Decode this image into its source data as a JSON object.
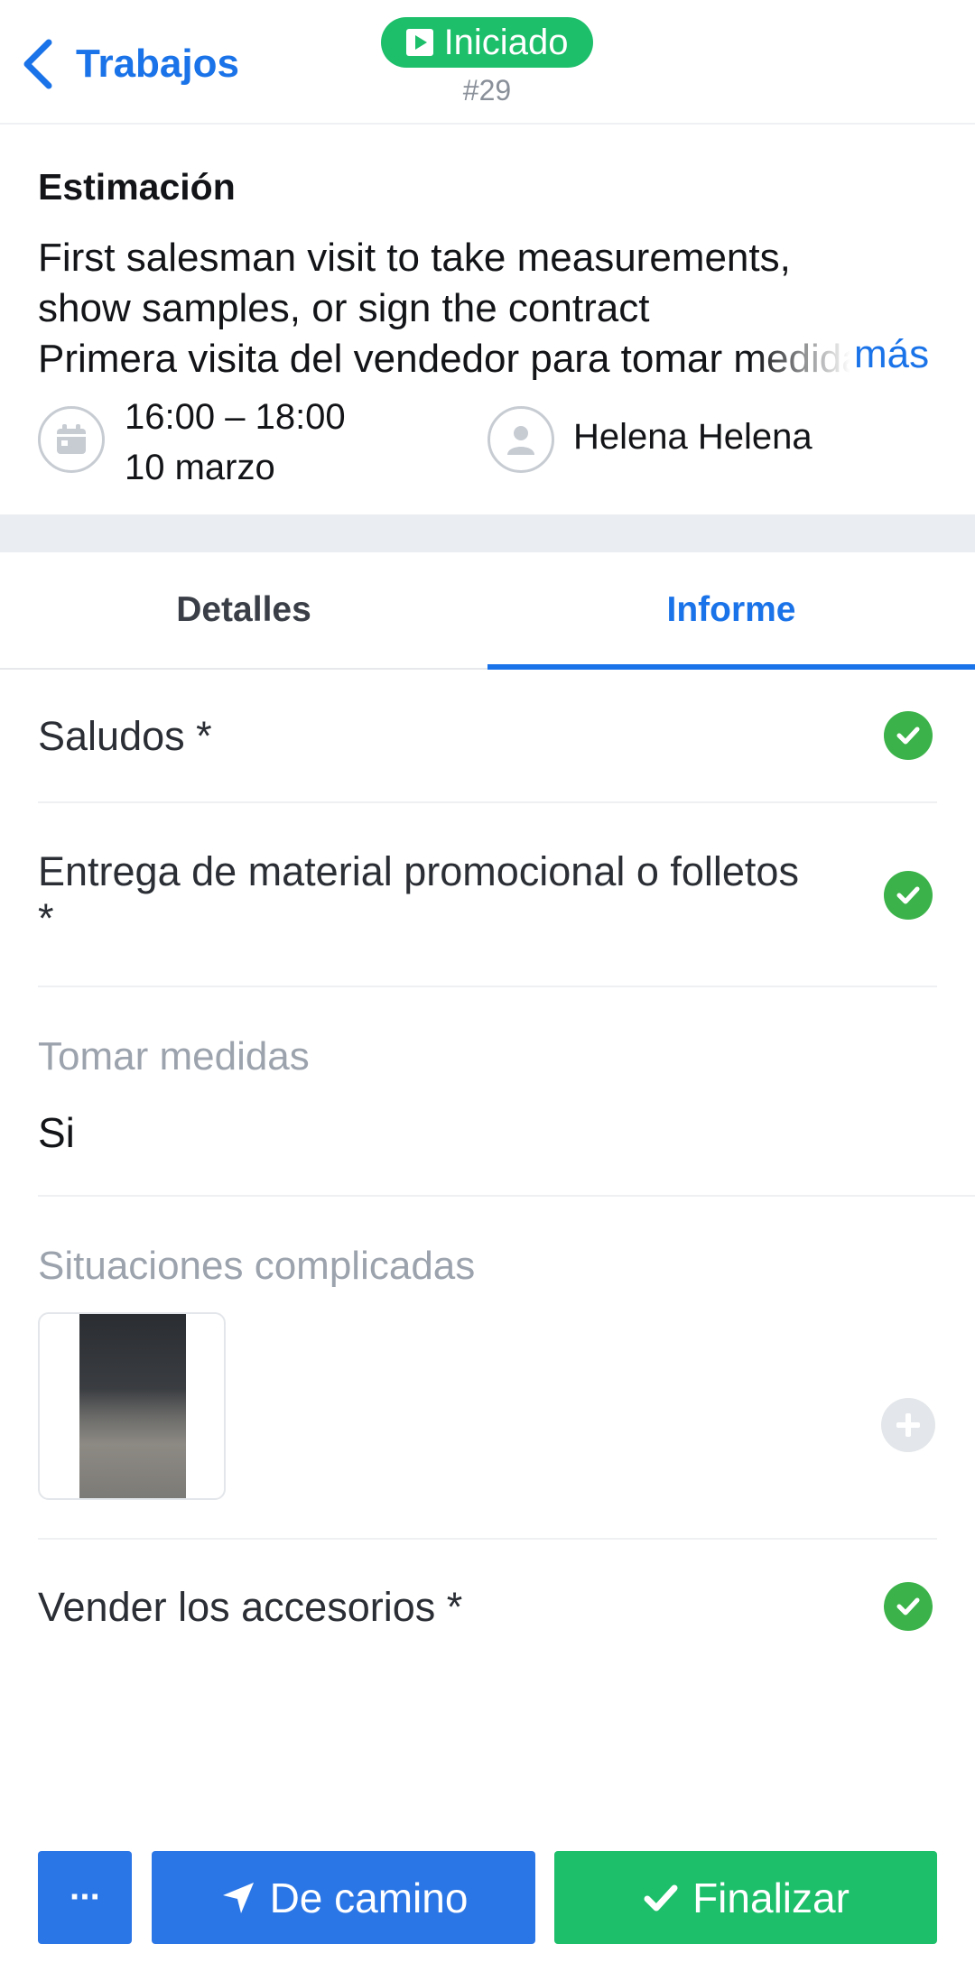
{
  "header": {
    "back_label": "Trabajos",
    "status_label": "Iniciado",
    "job_number": "#29"
  },
  "estimation": {
    "title": "Estimación",
    "description_lines": [
      "First salesman visit to take measurements,",
      "show samples, or sign the contract",
      "Primera visita del vendedor para tomar medidas"
    ],
    "more_label": "más",
    "time_range": "16:00 – 18:00",
    "date": "10 marzo",
    "assignee": "Helena Helena"
  },
  "tabs": [
    {
      "label": "Detalles",
      "active": false
    },
    {
      "label": "Informe",
      "active": true
    }
  ],
  "report": {
    "greetings": {
      "label": "Saludos *",
      "done": true
    },
    "promo": {
      "label_line1": "Entrega de material promocional o folletos",
      "label_line2": "*",
      "done": true
    },
    "measurements": {
      "label": "Tomar medidas",
      "value": "Si"
    },
    "complications": {
      "label": "Situaciones complicadas",
      "photo_count": 1
    },
    "accessories": {
      "label": "Vender los accesorios *",
      "done": true
    }
  },
  "actions": {
    "more_label": "···",
    "on_way_label": "De camino",
    "finish_label": "Finalizar"
  },
  "colors": {
    "accent_blue": "#1a73e8",
    "button_blue": "#2b76e6",
    "success_green": "#1dbf6b",
    "check_green": "#3cb34a"
  },
  "icons": [
    "chevron-left-icon",
    "play-icon",
    "calendar-icon",
    "user-icon",
    "check-icon",
    "plus-icon",
    "navigation-arrow-icon"
  ]
}
